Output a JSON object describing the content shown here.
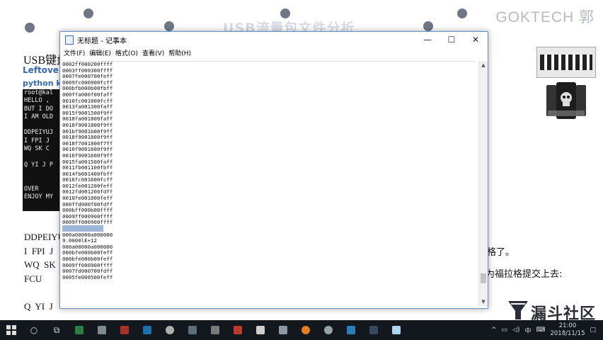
{
  "slide": {
    "title": "USB流量包文件分析",
    "brand": "GOKTECH 郭",
    "usb_keyboard": "USB键盘",
    "leftover": "Leftover",
    "python_line": "python k",
    "terminal_lines": [
      "root@kal",
      "HELLO , ",
      "BUT I DO",
      "I AM OLD",
      "",
      "DDPEIYUJ",
      "I FPI J ",
      "WQ SK C ",
      "",
      "Q YI J P",
      "",
      "",
      "OVER",
      "ENJOY MY"
    ],
    "serif_lines": [
      "DDPEIYU",
      "I  FPI  J",
      "WQ  SK  C",
      "FCU",
      "",
      "Q  YI  J"
    ],
    "right_text_1": "格了。",
    "right_text_2": "为福拉格提交上去:",
    "logo_text": "漏斗社区"
  },
  "notepad": {
    "title": "无标题 - 记事本",
    "menu": [
      "文件(F)",
      "编辑(E)",
      "格式(O)",
      "查看(V)",
      "帮助(H)"
    ],
    "lines": [
      "0002ff000200ffff",
      "0003ff000300ffff",
      "0007fe000700feff",
      "0009fc000900fcff",
      "000bfb000b00fbff",
      "000ffa000f00faff",
      "0010fc001000fcff",
      "0013fa001300faff",
      "0015f9001500f9ff",
      "0018fa001800faff",
      "0018f9001800f9ff",
      "001bf9001b00f9ff",
      "0018f9001800f9ff",
      "0018f7001800f7ff",
      "0016f9001600f9ff",
      "0016f9001600f9ff",
      "0015fa001500faff",
      "0011fb001100fbff",
      "0014fb001400fbff",
      "0016fc001600fcff",
      "0012fe001200feff",
      "0012fd001200fdff",
      "0010fe001000feff",
      "000ffd000f00fdff",
      "000bff000b00ffff",
      "0009ff000900ffff",
      "0009ff000900ffff",
      "",
      "000a00000a000000",
      "9.0000lE+12",
      "000a00000a000000",
      "000bfe000b00feff",
      "000bfe000b00feff",
      "0009ff000900ffff",
      "0007fd000700fdff",
      "0005fe000500feff"
    ],
    "selected_line_index": 27
  },
  "taskbar": {
    "ime": "中",
    "time": "21:00",
    "date": "2018/11/15"
  }
}
